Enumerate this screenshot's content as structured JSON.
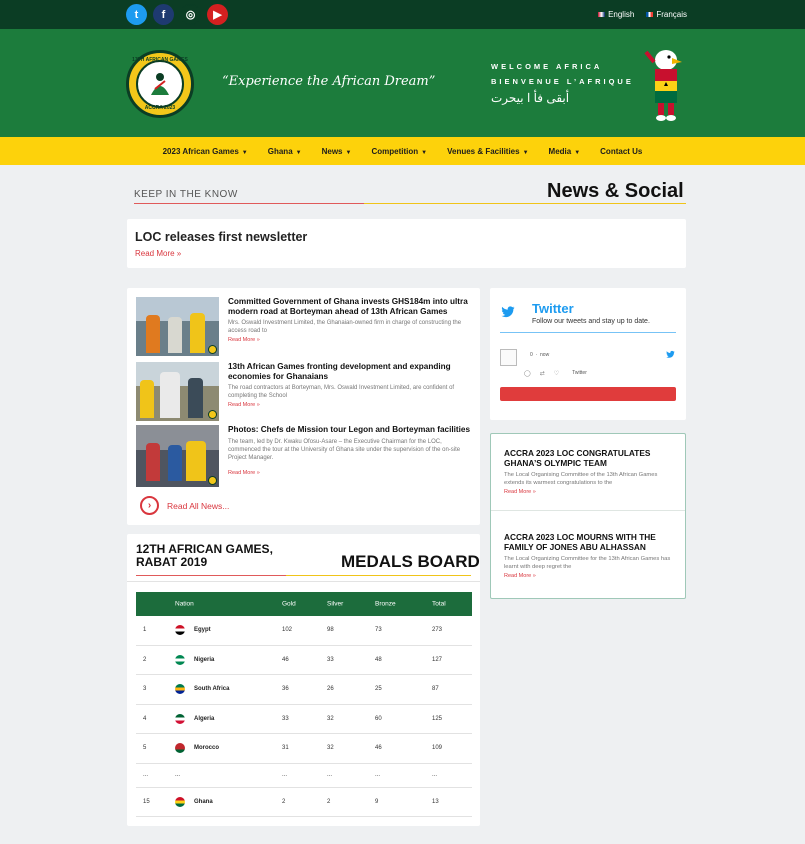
{
  "topbar": {
    "social": [
      {
        "icon": "twitter-icon",
        "glyph": "t",
        "color": "#1d9bf0"
      },
      {
        "icon": "facebook-icon",
        "glyph": "f",
        "color": "#1e3a70"
      },
      {
        "icon": "instagram-icon",
        "glyph": "◎",
        "color": "#0b3d24"
      },
      {
        "icon": "youtube-icon",
        "glyph": "▶",
        "color": "#d42020"
      }
    ],
    "lang_en": "English",
    "lang_fr": "Français"
  },
  "header": {
    "logo_text_top": "13TH AFRICAN GAMES",
    "logo_text_bottom": "ACCRA 2023",
    "tagline": "“Experience the African Dream”",
    "welcome_1": "WELCOME AFRICA",
    "welcome_2": "BIENVENUE L’AFRIQUE",
    "welcome_3": "أبقى فأ ا بيحرت"
  },
  "nav": [
    {
      "label": "2023 African Games",
      "caret": "▼"
    },
    {
      "label": "Ghana",
      "caret": "▼"
    },
    {
      "label": "News",
      "caret": "▼"
    },
    {
      "label": "Competition",
      "caret": "▼"
    },
    {
      "label": "Venues & Facilities",
      "caret": "▼"
    },
    {
      "label": "Media",
      "caret": "▼"
    },
    {
      "label": "Contact Us",
      "caret": ""
    }
  ],
  "section": {
    "kicker": "KEEP IN THE KNOW",
    "title": "News & Social"
  },
  "newsletter": {
    "title": "LOC releases first newsletter",
    "read_more": "Read More »"
  },
  "news": [
    {
      "headline": "Committed Government of Ghana invests GHS184m into ultra modern road at Borteyman ahead of 13th African Games",
      "excerpt": "Mrs. Oswald Investment Limited, the Ghanaian-owned firm in charge of constructing the access road to",
      "read_more": "Read More »"
    },
    {
      "headline": "13th African Games fronting development and expanding economies for Ghanaians",
      "excerpt": "The road contractors at Borteyman, Mrs. Oswald Investment Limited, are confident of completing the School",
      "read_more": "Read More »"
    },
    {
      "headline": "Photos: Chefs de Mission tour Legon and Borteyman facilities",
      "excerpt": "The team, led by Dr. Kwaku Ofosu-Asare – the Executive Chairman for the LOC, commenced the tour at the University of Ghana site under the supervision of the on-site Project Manager.",
      "read_more": "Read More »"
    }
  ],
  "read_all": "Read All News...",
  "twitter": {
    "title": "Twitter",
    "subtitle": "Follow our tweets and stay up to date.",
    "meta_count": "0",
    "meta_dot": "·",
    "meta_time": "now",
    "action_like": "♡",
    "action_retweet": "⇄",
    "action_reply": "◯",
    "action_label": "Twitter"
  },
  "posts": [
    {
      "title": "ACCRA 2023 LOC CONGRATULATES GHANA’S OLYMPIC TEAM",
      "excerpt": "The Local Organising Committee of the 13th African Games extends its warmest congratulations to the",
      "read_more": "Read More »"
    },
    {
      "title": "ACCRA 2023 LOC MOURNS WITH THE FAMILY OF JONES ABU ALHASSAN",
      "excerpt": "The Local Organizing Committee for the 13th African Games has learnt with deep regret the",
      "read_more": "Read More »"
    }
  ],
  "medals": {
    "title_line1": "12TH AFRICAN GAMES,",
    "title_line2": "RABAT 2019",
    "board": "MEDALS BOARD",
    "headers": {
      "nation": "Nation",
      "gold": "Gold",
      "silver": "Silver",
      "bronze": "Bronze",
      "total": "Total"
    },
    "rows": [
      {
        "rank": "1",
        "nation": "Egypt",
        "gold": "102",
        "silver": "98",
        "bronze": "73",
        "total": "273",
        "flag": [
          "#ce1126",
          "#ffffff",
          "#000000"
        ]
      },
      {
        "rank": "2",
        "nation": "Nigeria",
        "gold": "46",
        "silver": "33",
        "bronze": "48",
        "total": "127",
        "flag": [
          "#008751",
          "#ffffff",
          "#008751"
        ]
      },
      {
        "rank": "3",
        "nation": "South Africa",
        "gold": "36",
        "silver": "26",
        "bronze": "25",
        "total": "87",
        "flag": [
          "#007a4d",
          "#ffb612",
          "#002395"
        ]
      },
      {
        "rank": "4",
        "nation": "Algeria",
        "gold": "33",
        "silver": "32",
        "bronze": "60",
        "total": "125",
        "flag": [
          "#006233",
          "#ffffff",
          "#d21034"
        ]
      },
      {
        "rank": "5",
        "nation": "Morocco",
        "gold": "31",
        "silver": "32",
        "bronze": "46",
        "total": "109",
        "flag": [
          "#c1272d",
          "#c1272d",
          "#006233"
        ]
      },
      {
        "rank": "...",
        "nation": "...",
        "gold": "...",
        "silver": "...",
        "bronze": "...",
        "total": "...",
        "flag": null
      },
      {
        "rank": "15",
        "nation": "Ghana",
        "gold": "2",
        "silver": "2",
        "bronze": "9",
        "total": "13",
        "flag": [
          "#ce1126",
          "#fcd116",
          "#006b3f"
        ]
      }
    ]
  },
  "colors": {
    "topbar": "#0b3d24",
    "header": "#1c7c3c",
    "nav": "#fdd20b",
    "accent_red": "#d9363e",
    "table_head": "#1c6c3c"
  }
}
